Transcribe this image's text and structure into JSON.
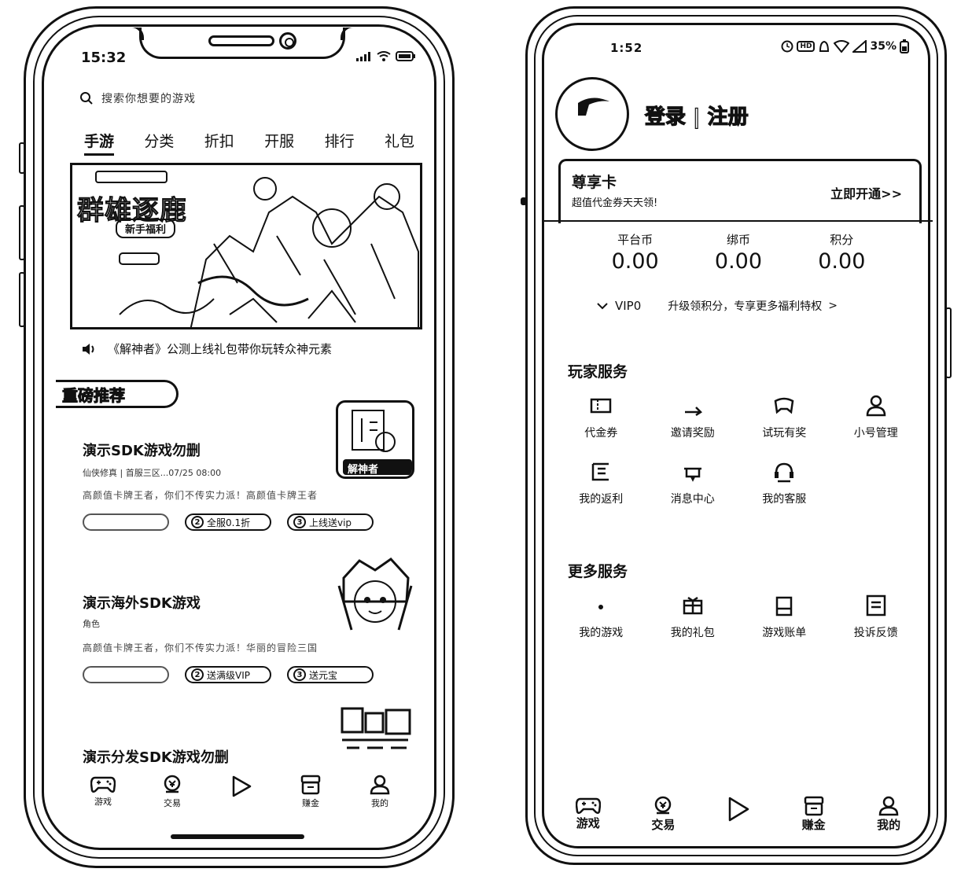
{
  "left_phone": {
    "status_bar": {
      "time": "15:32"
    },
    "search": {
      "placeholder": "搜索你想要的游戏"
    },
    "tabs": [
      {
        "label": "手游",
        "active": true
      },
      {
        "label": "分类",
        "active": false
      },
      {
        "label": "折扣",
        "active": false
      },
      {
        "label": "开服",
        "active": false
      },
      {
        "label": "排行",
        "active": false
      },
      {
        "label": "礼包",
        "active": false
      }
    ],
    "banner": {
      "title": "群雄逐鹿",
      "subtitle": "新手福利"
    },
    "notice": {
      "text": "《解神者》公测上线礼包带你玩转众神元素"
    },
    "recommend": {
      "badge": "重磅推荐"
    },
    "games": [
      {
        "title": "演示SDK游戏勿删",
        "meta": "仙侠修真 | 首服三区...07/25 08:00",
        "desc": "高颜值卡牌王者，你们不传实力派！高颜值卡牌王者，你们...",
        "tags": [
          {
            "num": "",
            "label": ""
          },
          {
            "num": "2",
            "label": "全服0.1折"
          },
          {
            "num": "3",
            "label": "上线送vip"
          }
        ],
        "thumb_text": "解神者"
      },
      {
        "title": "演示海外SDK游戏",
        "meta": "角色",
        "desc": "高颜值卡牌王者，你们不传实力派！华丽的冒险三国，历...",
        "tags": [
          {
            "num": "",
            "label": ""
          },
          {
            "num": "2",
            "label": "送满级VIP"
          },
          {
            "num": "3",
            "label": "送元宝"
          }
        ],
        "thumb_text": ""
      },
      {
        "title": "演示分发SDK游戏勿删",
        "meta": "",
        "desc": "",
        "tags": [],
        "thumb_text": ""
      }
    ],
    "tabbar": [
      {
        "label": "游戏",
        "icon": "gamepad-icon"
      },
      {
        "label": "交易",
        "icon": "trade-icon"
      },
      {
        "label": "",
        "icon": "play-icon"
      },
      {
        "label": "赚金",
        "icon": "store-icon"
      },
      {
        "label": "我的",
        "icon": "user-icon"
      }
    ]
  },
  "right_phone": {
    "status_bar": {
      "time": "1:52",
      "battery": "35%"
    },
    "profile": {
      "login_label": "登录 | 注册"
    },
    "vip_card": {
      "title": "尊享卡",
      "subtitle": "超值代金券天天领!",
      "action": "立即开通>>"
    },
    "wallet": [
      {
        "label": "平台币",
        "value": "0.00"
      },
      {
        "label": "绑币",
        "value": "0.00"
      },
      {
        "label": "积分",
        "value": "0.00"
      }
    ],
    "vip_row": {
      "level": "VIP0",
      "text": "升级领积分，专享更多福利特权",
      "arrow": ">"
    },
    "player_services": {
      "title": "玩家服务",
      "items": [
        {
          "label": "代金券",
          "icon": "voucher-icon"
        },
        {
          "label": "邀请奖励",
          "icon": "invite-icon"
        },
        {
          "label": "试玩有奖",
          "icon": "trial-icon"
        },
        {
          "label": "小号管理",
          "icon": "account-icon"
        },
        {
          "label": "我的返利",
          "icon": "rebate-icon"
        },
        {
          "label": "消息中心",
          "icon": "message-icon"
        },
        {
          "label": "我的客服",
          "icon": "support-icon"
        }
      ]
    },
    "more_services": {
      "title": "更多服务",
      "items": [
        {
          "label": "我的游戏",
          "icon": "my-games-icon"
        },
        {
          "label": "我的礼包",
          "icon": "gift-icon"
        },
        {
          "label": "游戏账单",
          "icon": "bill-icon"
        },
        {
          "label": "投诉反馈",
          "icon": "feedback-icon"
        }
      ]
    },
    "tabbar": [
      {
        "label": "游戏",
        "icon": "gamepad-icon"
      },
      {
        "label": "交易",
        "icon": "trade-icon"
      },
      {
        "label": "",
        "icon": "play-icon"
      },
      {
        "label": "赚金",
        "icon": "store-icon"
      },
      {
        "label": "我的",
        "icon": "user-icon"
      }
    ]
  }
}
